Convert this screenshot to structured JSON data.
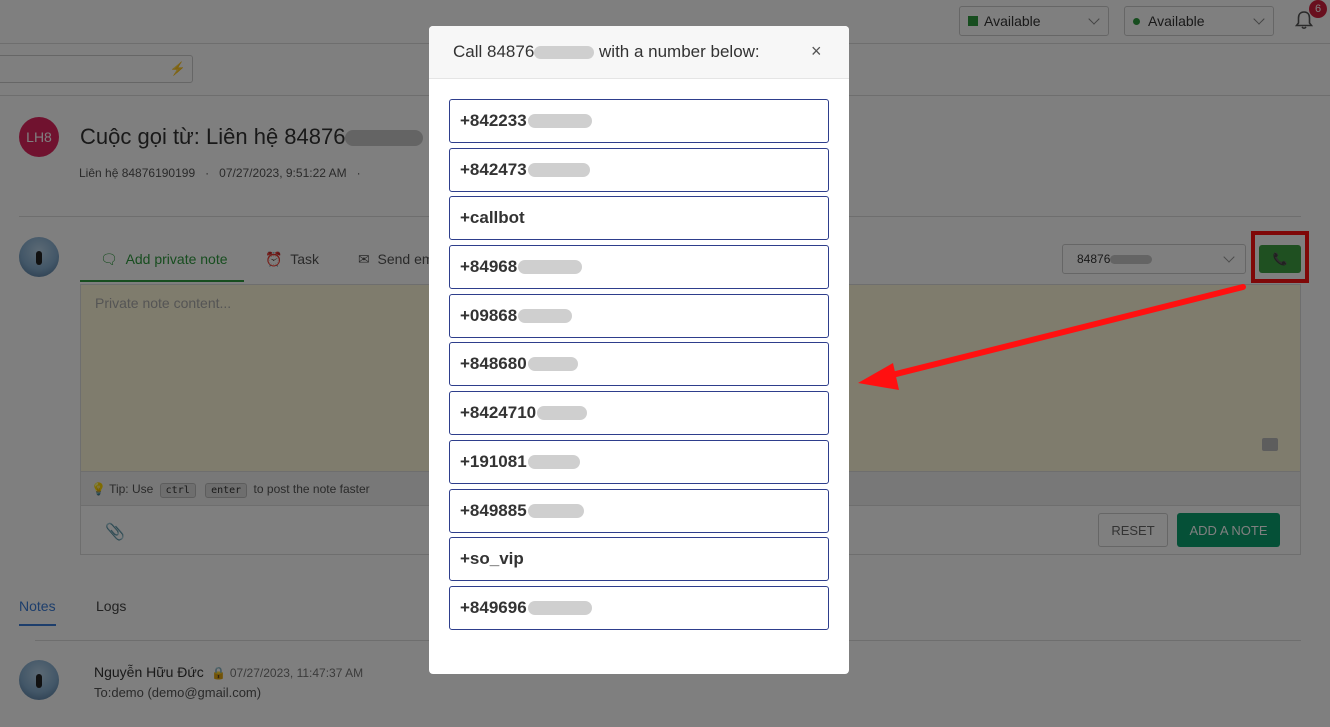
{
  "topbar": {
    "status_1": "Available",
    "status_2": "Available",
    "notification_count": "6"
  },
  "call": {
    "avatar_initials": "LH8",
    "title_prefix": "Cuộc gọi từ: Liên hệ 84876",
    "meta_contact": "Liên hệ 84876190199",
    "meta_separator": "·",
    "meta_time": "07/27/2023, 9:51:22 AM",
    "meta_trailing": "·"
  },
  "composer": {
    "tabs": [
      {
        "label": "Add private note"
      },
      {
        "label": "Task"
      },
      {
        "label": "Send email"
      }
    ],
    "phone_prefix": "84876",
    "placeholder": "Private note content...",
    "tip_prefix": "Tip: Use",
    "tip_key_1": "ctrl",
    "tip_key_2": "enter",
    "tip_suffix": "to post the note faster",
    "reset_label": "RESET",
    "add_note_label": "ADD A NOTE"
  },
  "history": {
    "tabs": [
      {
        "label": "Notes"
      },
      {
        "label": "Logs"
      }
    ],
    "entry": {
      "author": "Nguyễn Hữu Đức",
      "time": "07/27/2023, 11:47:37 AM",
      "to": "To:demo (demo@gmail.com)"
    }
  },
  "modal": {
    "title_prefix": "Call 84876",
    "title_suffix": "with a number below:",
    "close_symbol": "×",
    "numbers": [
      {
        "visible": "+842233",
        "redacted": true
      },
      {
        "visible": "+842473",
        "redacted": true
      },
      {
        "visible": "+callbot",
        "redacted": false
      },
      {
        "visible": "+84968",
        "redacted": true
      },
      {
        "visible": "+09868",
        "redacted": true
      },
      {
        "visible": "+848680",
        "redacted": true
      },
      {
        "visible": "+8424710",
        "redacted": true
      },
      {
        "visible": "+191081",
        "redacted": true
      },
      {
        "visible": "+849885",
        "redacted": true
      },
      {
        "visible": "+so_vip",
        "redacted": false
      },
      {
        "visible": "+849696",
        "redacted": true
      }
    ]
  },
  "colors": {
    "accent_green": "#2e9a3e",
    "add_note_green": "#0aa06e",
    "highlight_red": "#ff1010",
    "badge_red": "#d21f3c",
    "number_border": "#2e3e8c"
  }
}
